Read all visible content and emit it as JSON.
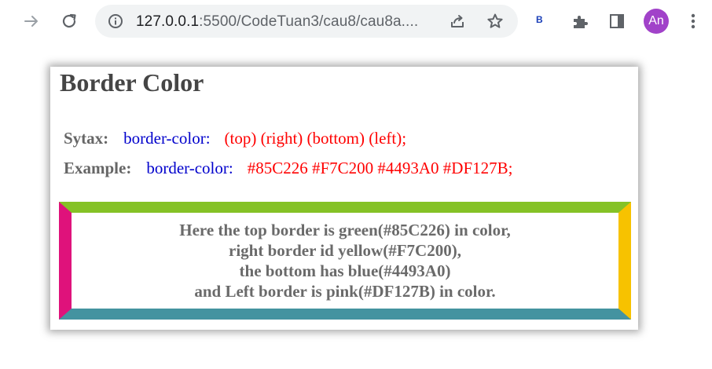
{
  "browser": {
    "url_host": "127.0.0.1",
    "url_path": ":5500/CodeTuan3/cau8/cau8a....",
    "extension_badge": "B",
    "profile_initials": "An",
    "profile_color": "#a142c9",
    "icons": [
      "forward-icon",
      "reload-icon",
      "info-icon",
      "share-icon",
      "star-icon",
      "puzzle-icon",
      "side-panel-icon",
      "menu-icon"
    ]
  },
  "page": {
    "title": "Border Color",
    "syntax": {
      "label": "Sytax:",
      "property": "border-color:",
      "value": "(top) (right) (bottom) (left);"
    },
    "example": {
      "label": "Example:",
      "property": "border-color:",
      "value": "#85C226 #F7C200 #4493A0 #DF127B;"
    },
    "demo": {
      "lines": [
        "Here the top border is green(#85C226) in color,",
        "right border id yellow(#F7C200),",
        "the bottom has blue(#4493A0)",
        "and Left border is pink(#DF127B) in color."
      ],
      "colors": {
        "top": "#85C226",
        "right": "#F7C200",
        "bottom": "#4493A0",
        "left": "#DF127B"
      }
    }
  }
}
